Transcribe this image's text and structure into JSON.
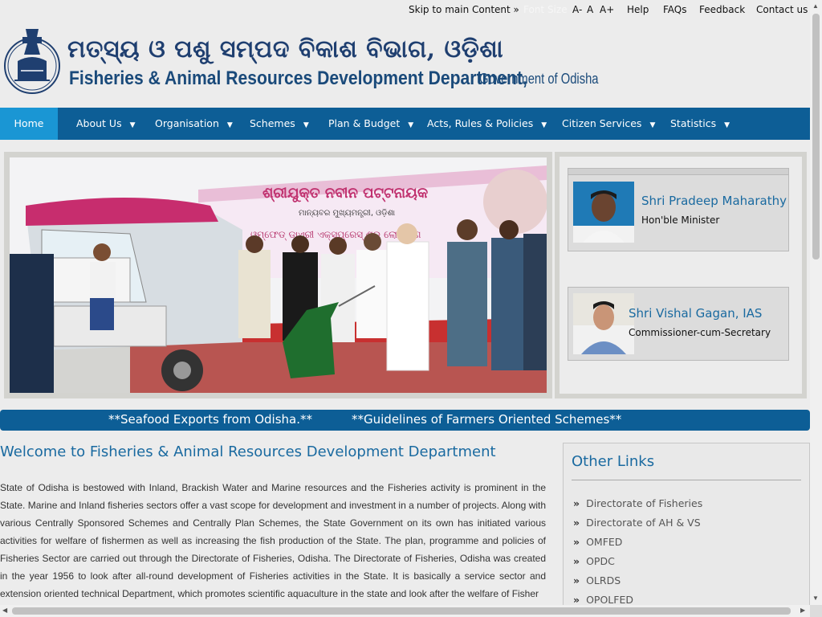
{
  "topbar": {
    "skip": "Skip to main Content »",
    "font_size_label": "Font Size",
    "font_minus": "A-",
    "font_normal": "A",
    "font_plus": "A+",
    "help": "Help",
    "faqs": "FAQs",
    "feedback": "Feedback",
    "contact": "Contact us"
  },
  "header": {
    "odia_title": "ମତ୍ସ୍ୟ ଓ ପଶୁ ସମ୍ପଦ ବିକାଶ ବିଭାଗ, ଓଡ଼ିଶା",
    "english_title": "Fisheries & Animal Resources Development Department,",
    "government": "Government of Odisha"
  },
  "nav": {
    "home": "Home",
    "items": [
      "About Us",
      "Organisation",
      "Schemes",
      "Plan & Budget",
      "Acts, Rules & Policies",
      "Citizen Services",
      "Statistics"
    ]
  },
  "banner": {
    "banner_text_1": "ଶ୍ରୀଯୁକ୍ତ ନବୀନ ପଟ୍ଟନାୟକ",
    "banner_text_2": "ମାନ୍ୟବର ମୁଖ୍ୟମନ୍ତ୍ରୀ, ଓଡ଼ିଶା",
    "banner_text_3": "ଓମ୍ଫେଡ୍ ଡାଏରୀ ଏକ୍ସପ୍ରେସ୍ ଶୁଭ ଲୋକାର୍ପଣ"
  },
  "leaders": [
    {
      "name": "Shri Pradeep Maharathy",
      "designation": "Hon'ble Minister"
    },
    {
      "name": "Shri Vishal Gagan, IAS",
      "designation": "Commissioner-cum-Secretary"
    }
  ],
  "ticker": {
    "item1": "**Seafood Exports from Odisha.**",
    "item2": "**Guidelines of Farmers Oriented Schemes**"
  },
  "welcome": {
    "title": "Welcome to Fisheries & Animal Resources Development Department",
    "text": "State of Odisha is bestowed with Inland, Brackish Water and Marine resources and the Fisheries activity is prominent in the State. Marine and Inland fisheries sectors offer a vast scope for development and investment in a number of projects. Along with various Centrally Sponsored Schemes and Centrally Plan Schemes, the State Government on its own has initiated various activities for welfare of fishermen as well as increasing the fish production of the State. The plan, programme and policies of Fisheries Sector are carried out through the Directorate of Fisheries, Odisha. The Directorate of Fisheries, Odisha was created in the year 1956 to look after all-round development of Fisheries activities in the State. It is basically a service sector and extension oriented technical Department, which promotes scientific aquaculture in the state and look after the welfare of Fisher"
  },
  "other_links": {
    "title": "Other Links",
    "bullet": "»",
    "items": [
      "Directorate of Fisheries",
      "Directorate of AH & VS",
      "OMFED",
      "OPDC",
      "OLRDS",
      "OPOLFED"
    ]
  },
  "colors": {
    "nav_bg": "#0d5e96",
    "home_bg": "#1a96d4",
    "accent_text": "#1a6aa0"
  }
}
